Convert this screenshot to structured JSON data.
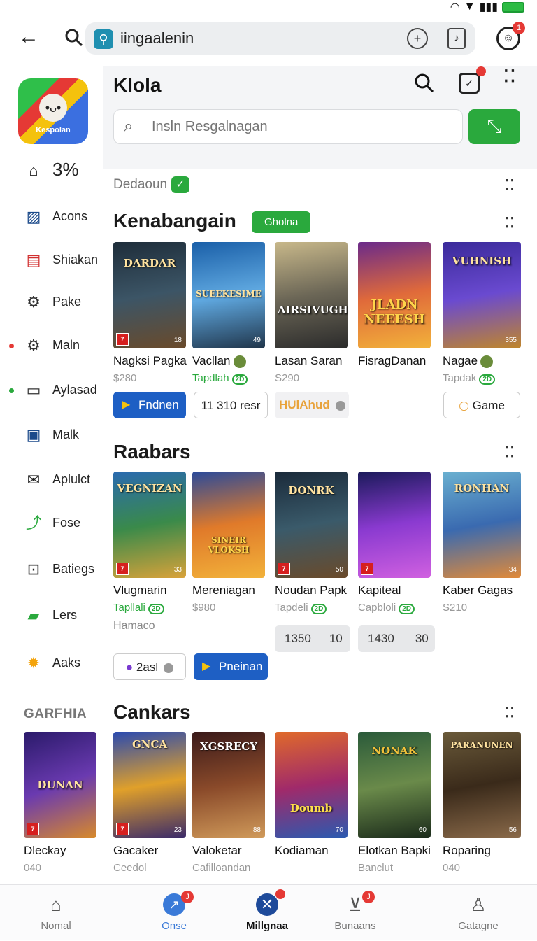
{
  "browser": {
    "url_text": "iingaalenin",
    "profile_badge": "1"
  },
  "sidebar": {
    "logo_text": "Kespolan",
    "items": [
      {
        "label": "3%",
        "icon": "home-icon"
      },
      {
        "label": "Acons",
        "icon": "picture-icon"
      },
      {
        "label": "Shiakan",
        "icon": "chart-icon"
      },
      {
        "label": "Pake",
        "icon": "gear-icon"
      },
      {
        "label": "Maln",
        "icon": "gear-icon"
      },
      {
        "label": "Aylasad",
        "icon": "window-icon"
      },
      {
        "label": "Malk",
        "icon": "card-icon"
      },
      {
        "label": "Aplulct",
        "icon": "mail-icon"
      },
      {
        "label": "Fose",
        "icon": "chart-line-icon"
      },
      {
        "label": "Batiegs",
        "icon": "box-icon"
      },
      {
        "label": "Lers",
        "icon": "chat-icon"
      },
      {
        "label": "Aaks",
        "icon": "sun-icon"
      }
    ],
    "heading": "GARFHIA"
  },
  "header": {
    "title": "Klola",
    "search_placeholder": "Insln Resgalnagan"
  },
  "filter": {
    "label": "Dedaoun"
  },
  "sections": [
    {
      "title": "Kenabangain",
      "badge": "Gholna",
      "cards": [
        {
          "cover": "DARDAR",
          "num": "18",
          "name": "Nagksi Pagka",
          "sub": "$280"
        },
        {
          "cover": "SUEEKESIME",
          "num": "49",
          "name": "Vacllan",
          "sub": "Tapdlah",
          "sub_badge": "2D"
        },
        {
          "cover": "AIRSIVUGH",
          "num": "",
          "name": "Lasan Saran",
          "sub": "S290"
        },
        {
          "cover": "JLADN NEEESH",
          "num": "",
          "name": "FisragDanan",
          "sub": ""
        },
        {
          "cover": "VUHNISH",
          "num": "355",
          "name": "Nagae",
          "sub": "Tapdak",
          "sub_badge": "2D"
        }
      ],
      "pills": [
        "Fndnen",
        "11 310 resr",
        "HUlAhud",
        "Game"
      ]
    },
    {
      "title": "Raabars",
      "cards": [
        {
          "cover": "VEGNIZAN",
          "num": "33",
          "name": "Vlugmarin",
          "sub": "Tapllali",
          "sub_badge": "2D",
          "extra": "Hamaco"
        },
        {
          "cover": "SINEIR VLOKSH",
          "num": "",
          "name": "Mereniagan",
          "sub": "$980"
        },
        {
          "cover": "DONRK",
          "num": "50",
          "name": "Noudan Papk",
          "sub": "Tapdeli",
          "sub_badge": "2D"
        },
        {
          "cover": "",
          "num": "",
          "name": "Kapiteal",
          "sub": "Capbloli",
          "sub_badge": "2D"
        },
        {
          "cover": "RONHAN",
          "num": "34",
          "name": "Kaber Gagas",
          "sub": "S210"
        }
      ],
      "pills": [
        "2asl",
        "Pneinan",
        "1350",
        "10",
        "1430",
        "30"
      ]
    },
    {
      "title": "Cankars",
      "cards": [
        {
          "cover": "GNCA",
          "num": "23",
          "name": "Gacaker",
          "sub": "Ceedol"
        },
        {
          "cover": "XGSRECY",
          "num": "88",
          "name": "Valoketar",
          "sub": "Cafilloandan"
        },
        {
          "cover": "Doumb",
          "num": "70",
          "name": "Kodiaman",
          "sub": ""
        },
        {
          "cover": "NONAK",
          "num": "60",
          "name": "Elotkan Bapki",
          "sub": "Banclut"
        },
        {
          "cover": "PARANUNEN",
          "num": "56",
          "name": "Roparing",
          "sub": "040"
        }
      ]
    }
  ],
  "side_game": {
    "cover": "DUNAN",
    "name": "Dleckay",
    "sub": "040"
  },
  "bottom_nav": [
    {
      "label": "Nomal",
      "icon": "home-icon",
      "badge": ""
    },
    {
      "label": "Onse",
      "icon": "trend-icon",
      "badge": "J"
    },
    {
      "label": "Millgnaa",
      "icon": "close-circle-icon",
      "badge": ""
    },
    {
      "label": "Bunaans",
      "icon": "inbox-icon",
      "badge": "J"
    },
    {
      "label": "Gatagne",
      "icon": "person-icon",
      "badge": ""
    }
  ],
  "colors": {
    "accent_green": "#2aa93d",
    "accent_blue": "#1e5fc4",
    "badge_red": "#e53935"
  }
}
